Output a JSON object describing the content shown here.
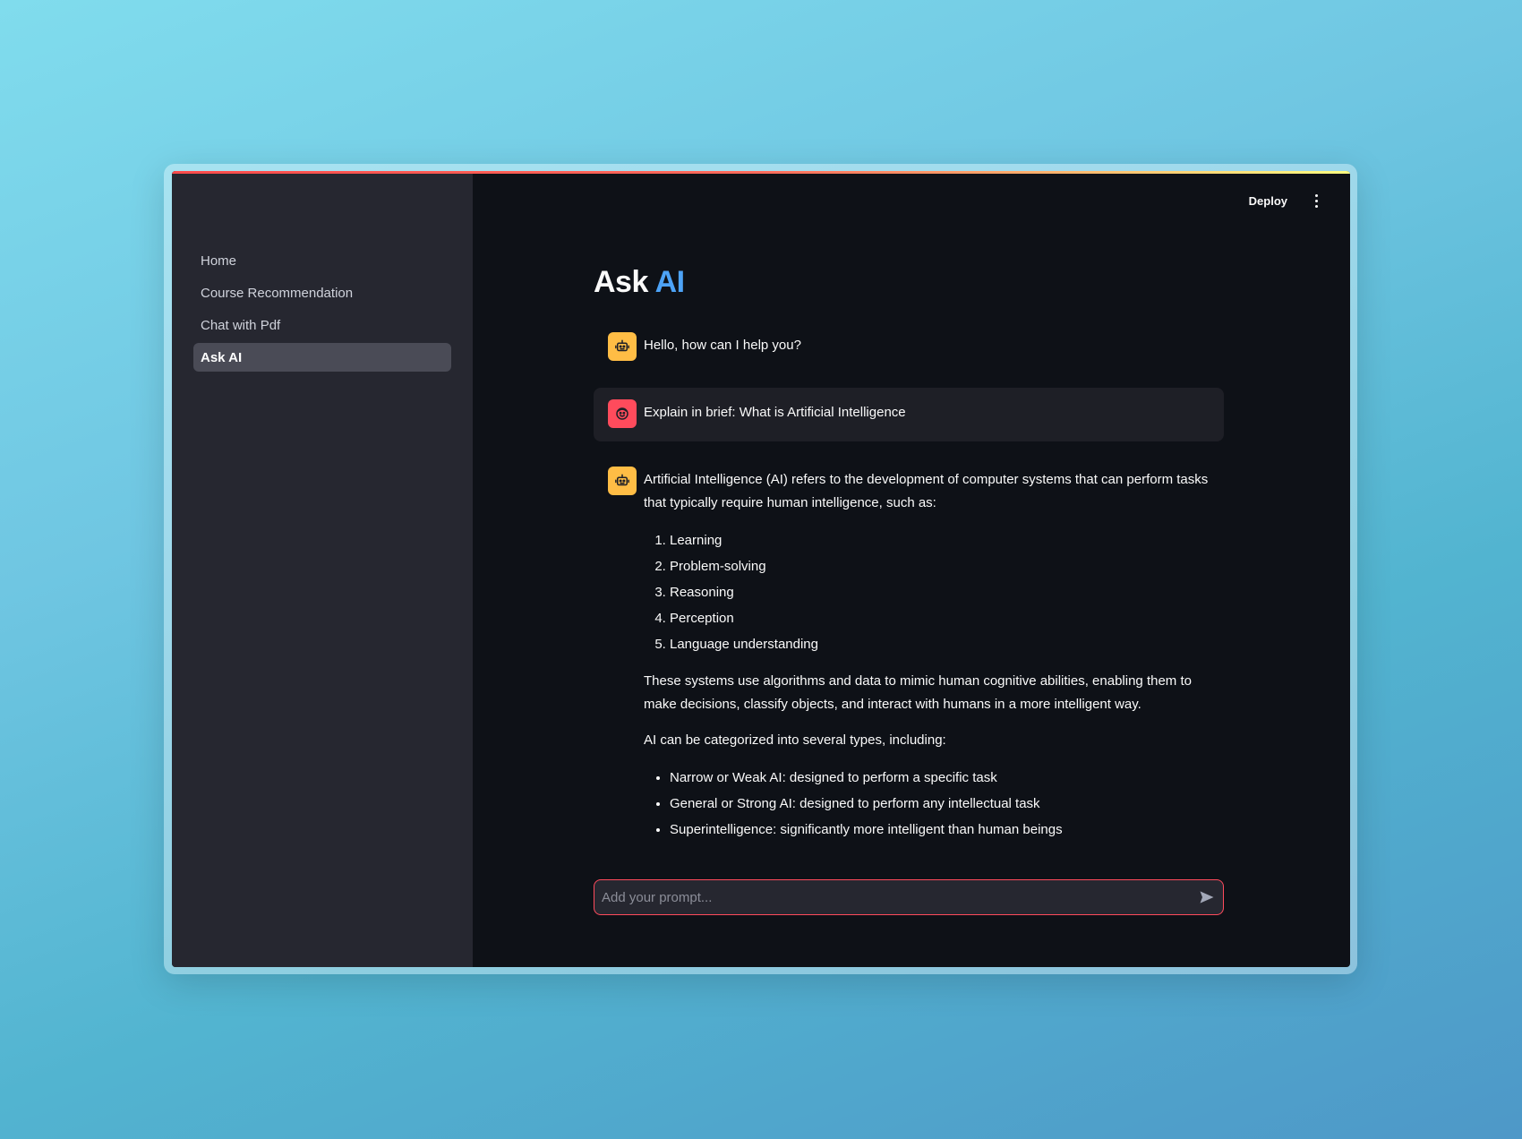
{
  "sidebar": {
    "items": [
      {
        "label": "Home",
        "active": false
      },
      {
        "label": "Course Recommendation",
        "active": false
      },
      {
        "label": "Chat with Pdf",
        "active": false
      },
      {
        "label": "Ask AI",
        "active": true
      }
    ]
  },
  "header": {
    "deploy_label": "Deploy",
    "menu_icon": "kebab-menu-icon"
  },
  "main": {
    "title_part1": "Ask",
    "title_part2": "AI",
    "messages": [
      {
        "role": "assistant",
        "avatar_icon": "robot-icon",
        "text": "Hello, how can I help you?"
      },
      {
        "role": "user",
        "avatar_icon": "user-face-icon",
        "text": "Explain in brief: What is Artificial Intelligence"
      },
      {
        "role": "assistant",
        "avatar_icon": "robot-icon",
        "intro": "Artificial Intelligence (AI) refers to the development of computer systems that can perform tasks that typically require human intelligence, such as:",
        "ordered_items": [
          "Learning",
          "Problem-solving",
          "Reasoning",
          "Perception",
          "Language understanding"
        ],
        "paragraph": "These systems use algorithms and data to mimic human cognitive abilities, enabling them to make decisions, classify objects, and interact with humans in a more intelligent way.",
        "types_intro": "AI can be categorized into several types, including:",
        "bullet_items": [
          "Narrow or Weak AI: designed to perform a specific task",
          "General or Strong AI: designed to perform any intellectual task",
          "Superintelligence: significantly more intelligent than human beings"
        ]
      }
    ]
  },
  "input": {
    "placeholder": "Add your prompt...",
    "value": "",
    "send_icon": "send-icon"
  },
  "colors": {
    "accent_blue": "#4da3f7",
    "assistant_avatar": "#ffbd45",
    "user_avatar": "#ff4b5c",
    "sidebar_bg": "#262730",
    "main_bg": "#0e1117"
  }
}
